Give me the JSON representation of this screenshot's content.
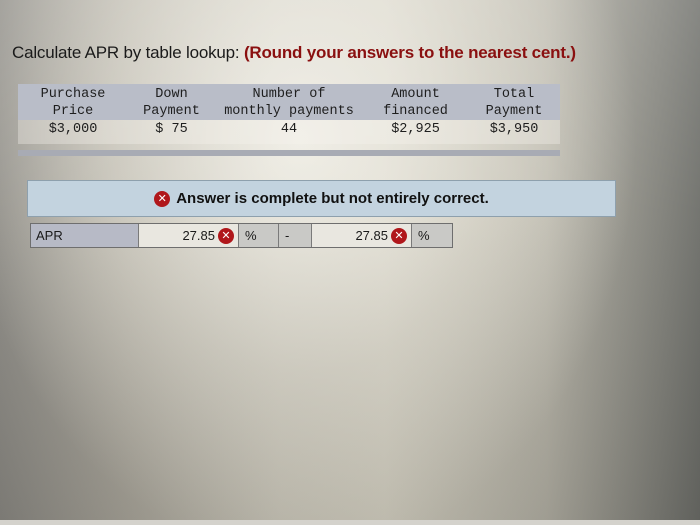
{
  "question": {
    "prompt": "Calculate APR by table lookup: ",
    "instruction": "(Round your answers to the nearest cent.)"
  },
  "given_table": {
    "columns": [
      {
        "header_line1": "Purchase",
        "header_line2": "Price",
        "value": "$3,000"
      },
      {
        "header_line1": "Down",
        "header_line2": "Payment",
        "value": "$ 75"
      },
      {
        "header_line1": "Number of",
        "header_line2": "monthly payments",
        "value": "44"
      },
      {
        "header_line1": "Amount",
        "header_line2": "financed",
        "value": "$2,925"
      },
      {
        "header_line1": "Total",
        "header_line2": "Payment",
        "value": "$3,950"
      }
    ]
  },
  "feedback": {
    "icon": "incorrect-x-icon",
    "message": "Answer is complete but not entirely correct.",
    "status_color": "#b0171b"
  },
  "answer_row": {
    "label": "APR",
    "low_value": "27.85",
    "low_status": "incorrect",
    "low_unit": "%",
    "separator": "-",
    "high_value": "27.85",
    "high_status": "incorrect",
    "high_unit": "%"
  },
  "icons": {
    "incorrect_glyph": "✕"
  }
}
